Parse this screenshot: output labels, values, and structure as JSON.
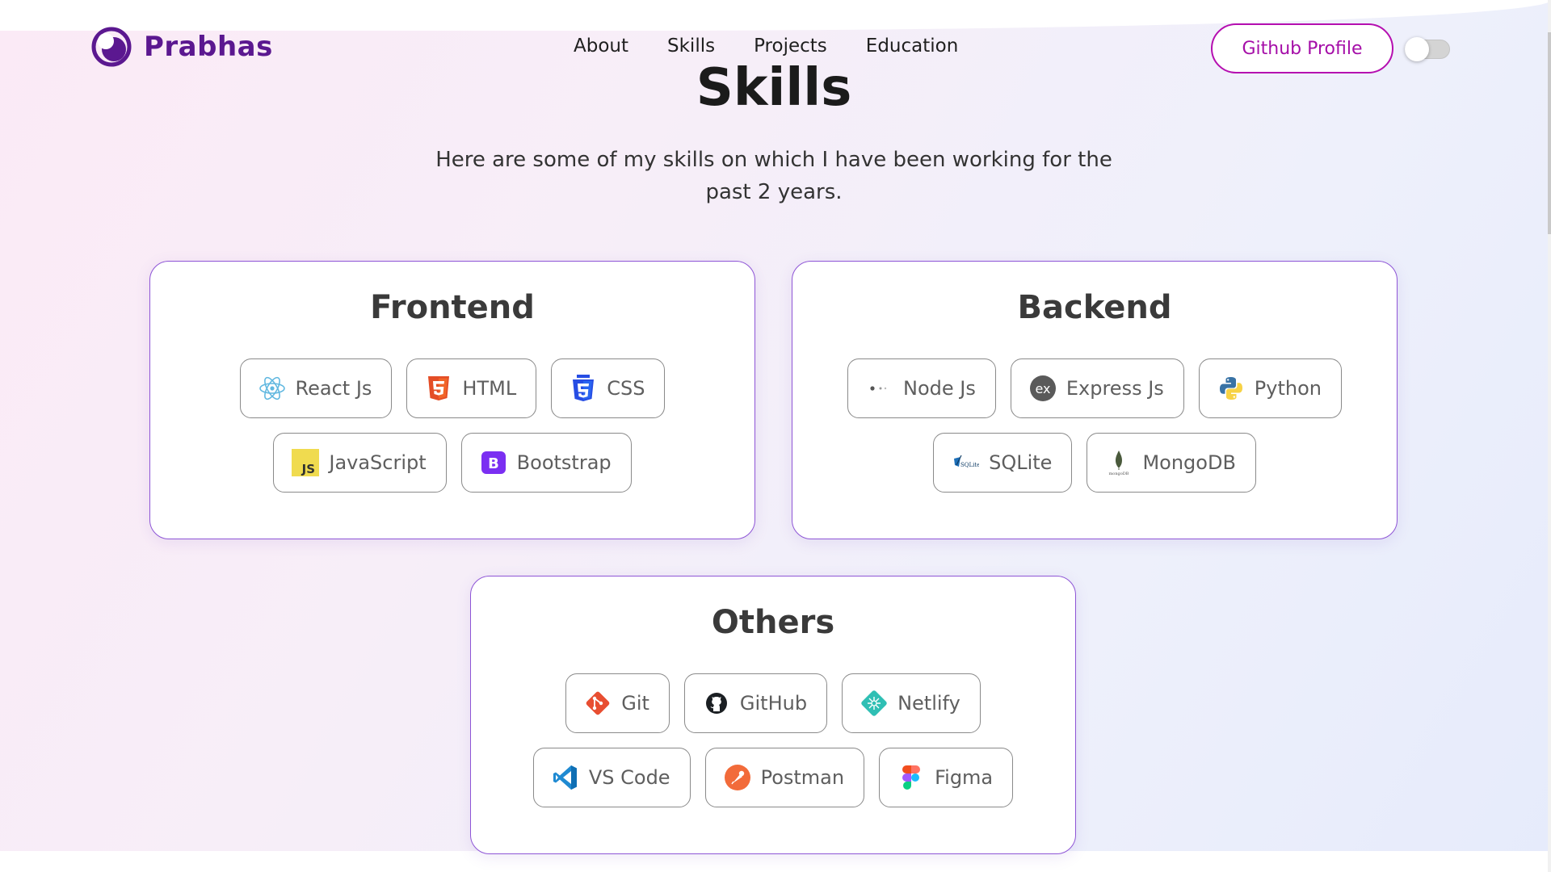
{
  "nav": {
    "brand": "Prabhas",
    "links": [
      "About",
      "Skills",
      "Projects",
      "Education"
    ],
    "github_button": "Github Profile",
    "theme_toggle": {
      "on": false
    }
  },
  "header": {
    "title": "Skills",
    "description": "Here are some of my skills on which I have been working for the past 2 years."
  },
  "cards": [
    {
      "title": "Frontend",
      "rows": [
        [
          {
            "name": "React Js",
            "icon": "react-icon"
          },
          {
            "name": "HTML",
            "icon": "html5-icon"
          },
          {
            "name": "CSS",
            "icon": "css3-icon"
          }
        ],
        [
          {
            "name": "JavaScript",
            "icon": "javascript-icon"
          },
          {
            "name": "Bootstrap",
            "icon": "bootstrap-icon"
          }
        ]
      ]
    },
    {
      "title": "Backend",
      "rows": [
        [
          {
            "name": "Node Js",
            "icon": "nodejs-icon"
          },
          {
            "name": "Express Js",
            "icon": "express-icon"
          },
          {
            "name": "Python",
            "icon": "python-icon"
          }
        ],
        [
          {
            "name": "SQLite",
            "icon": "sqlite-icon"
          },
          {
            "name": "MongoDB",
            "icon": "mongodb-icon"
          }
        ]
      ]
    },
    {
      "title": "Others",
      "rows": [
        [
          {
            "name": "Git",
            "icon": "git-icon"
          },
          {
            "name": "GitHub",
            "icon": "github-icon"
          },
          {
            "name": "Netlify",
            "icon": "netlify-icon"
          }
        ],
        [
          {
            "name": "VS Code",
            "icon": "vscode-icon"
          },
          {
            "name": "Postman",
            "icon": "postman-icon"
          },
          {
            "name": "Figma",
            "icon": "figma-icon"
          }
        ]
      ]
    }
  ],
  "colors": {
    "brand": "#5b1890",
    "accent": "#b50fb0",
    "card_border": "#8e55d6"
  }
}
